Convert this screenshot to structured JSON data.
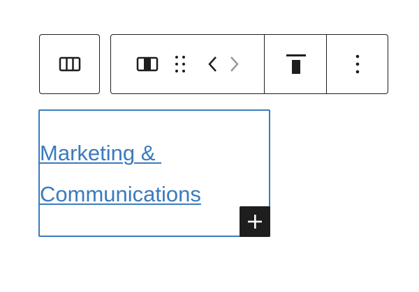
{
  "toolbar": {
    "parent_icon": "columns-icon",
    "block_type_icon": "column-icon",
    "drag_icon": "drag-handle-icon",
    "move_left_icon": "chevron-left-icon",
    "move_right_icon": "chevron-right-icon",
    "align_icon": "align-top-icon",
    "more_icon": "more-vertical-icon"
  },
  "block": {
    "link_text": "Marketing & Communications",
    "inserter_icon": "plus-icon"
  },
  "colors": {
    "accent": "#3a7bbd",
    "toolbar_border": "#1e1e1e",
    "inserter_bg": "#1e1e1e",
    "disabled_icon": "#9a9a9a"
  }
}
